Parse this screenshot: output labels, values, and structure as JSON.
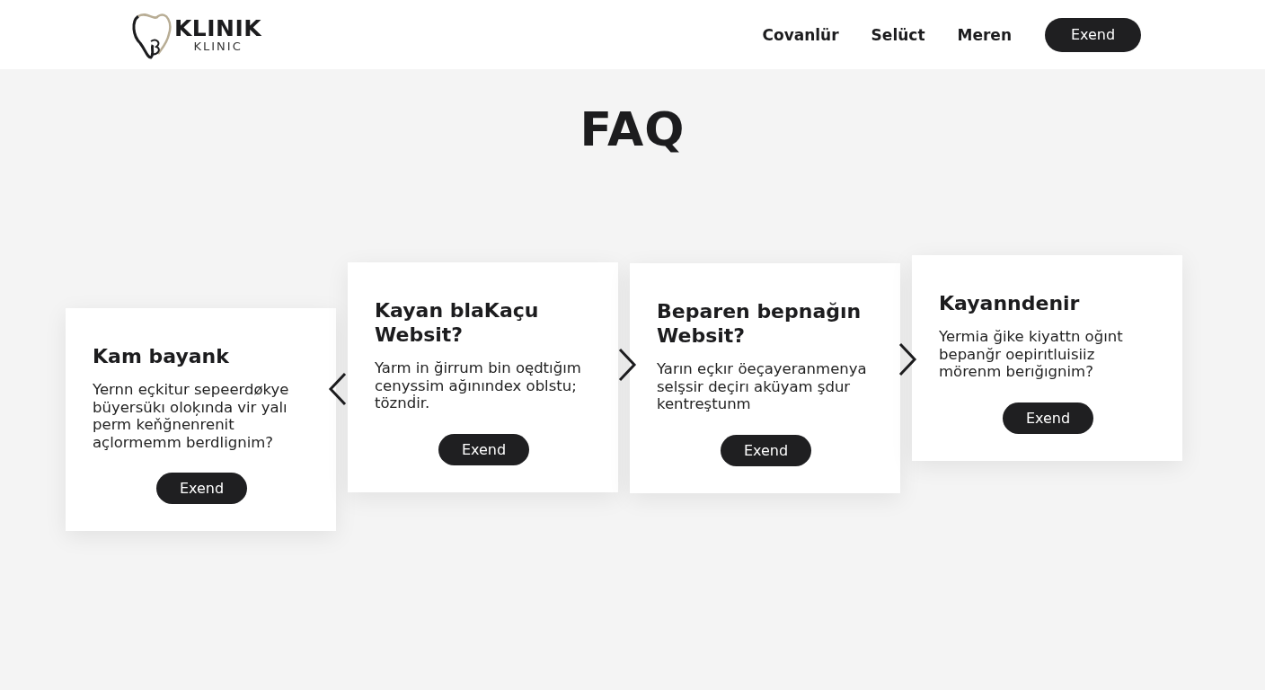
{
  "header": {
    "logo": {
      "name": "KLINIK",
      "subtitle": "KLINIC"
    },
    "nav": [
      "Covanlür",
      "Selüct",
      "Meren"
    ],
    "cta": "Exend"
  },
  "page_title": "FAQ",
  "cards": [
    {
      "title": "Kam bayank",
      "body": "Yernn eçkitur sepeerdøkye büyersükı oloķında vir yalı perm keňğnenrenit açlormemm berdlignim?",
      "button": "Exend"
    },
    {
      "title": "Kayan blaKaçu Websit?",
      "body": "Yarm in ğirrum bin oędtığım cenyssim ağınındex oblstu; töznḋir.",
      "button": "Exend"
    },
    {
      "title": "Beparen bepnağın Websit?",
      "body": "Yarın eçkır öeçayeranmenya selşsir deçirı aküyam şdur kentreştunm",
      "button": "Exend"
    },
    {
      "title": "Kayanndenir",
      "body": "Yermia ğike kiyattn oğınt bepanğr oepirıtluisiiz mörenm berığıgnim?",
      "button": "Exend"
    }
  ]
}
